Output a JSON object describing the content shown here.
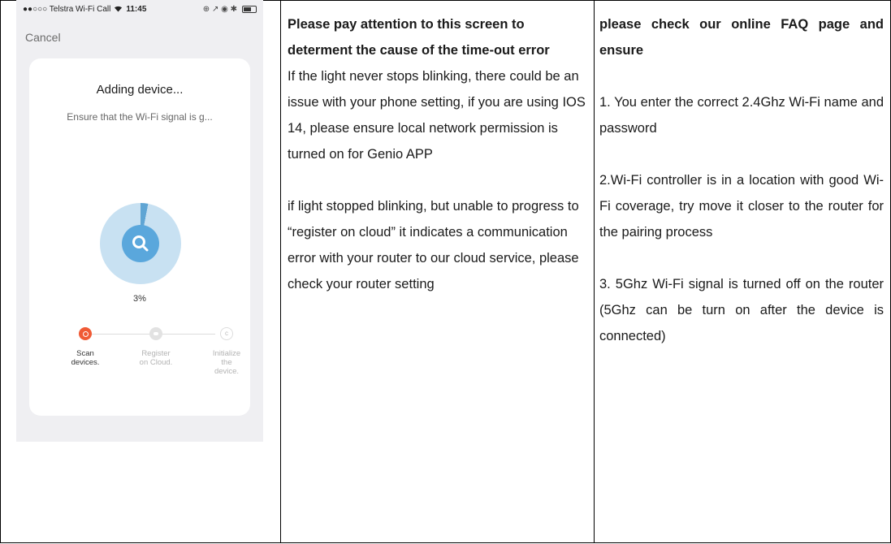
{
  "phone": {
    "carrier": "●●○○○ Telstra Wi-Fi Call",
    "time": "11:45",
    "status_icons": "⊕ ↗ ◉ ✱",
    "cancel": "Cancel",
    "card_title": "Adding device...",
    "card_subtitle": "Ensure that the Wi-Fi signal is g...",
    "percent": "3%",
    "progress_value": 0.03,
    "steps": [
      {
        "line1": "Scan",
        "line2": "devices.",
        "line3": ""
      },
      {
        "line1": "Register",
        "line2": "on Cloud.",
        "line3": ""
      },
      {
        "line1": "Initialize",
        "line2": "the",
        "line3": "device."
      }
    ],
    "colors": {
      "accent": "#5aa7dc",
      "active_step": "#f05a35"
    },
    "icons": [
      "search-icon",
      "wifi-icon",
      "battery-icon"
    ]
  },
  "column2": {
    "heading": "Please pay attention to this screen to determent the cause of the time-out error",
    "para1": "If the light never stops blinking, there could be an issue with your phone setting, if you are using IOS 14, please ensure local network permission is turned on for Genio APP",
    "para2": "if light stopped blinking, but unable to progress to “register on cloud” it indicates a communication error with your router to our cloud service, please check your router setting"
  },
  "column3": {
    "heading": "please check our online FAQ page and ensure",
    "item1": "1. You enter the correct 2.4Ghz Wi-Fi name and password",
    "item2": "2.Wi-Fi controller is in a location with good Wi-Fi coverage, try move it closer to the router for the pairing process",
    "item3": "3. 5Ghz Wi-Fi signal is turned off on the router (5Ghz can be turn on after the device is connected)"
  }
}
